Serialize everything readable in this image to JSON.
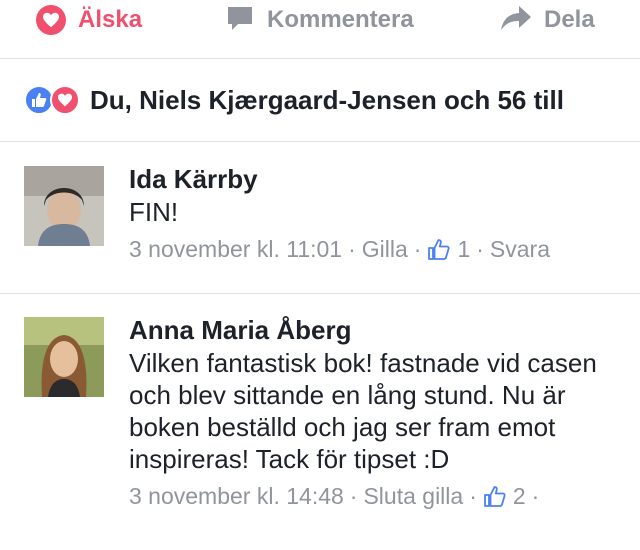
{
  "actions": {
    "love_label": "Älska",
    "comment_label": "Kommentera",
    "share_label": "Dela"
  },
  "reactions": {
    "summary": "Du, Niels Kjærgaard-Jensen och 56 till"
  },
  "comments": [
    {
      "author": "Ida Kärrby",
      "text": "FIN!",
      "timestamp": "3 november kl. 11:01",
      "like_action": "Gilla",
      "like_count": "1",
      "reply_action": "Svara"
    },
    {
      "author": "Anna Maria Åberg",
      "text": "Vilken fantastisk bok! fastnade vid casen och blev sittande en lång stund. Nu är boken beställd och jag ser fram emot inspireras! Tack för tipset :D",
      "timestamp": "3 november kl. 14:48",
      "like_action": "Sluta gilla",
      "like_count": "2"
    }
  ],
  "colors": {
    "love": "#f0506e",
    "like": "#4b80f4",
    "muted": "#90949c",
    "text": "#1d2129",
    "divider": "#dddfe2"
  },
  "icons": [
    "heart-icon",
    "comment-icon",
    "share-icon",
    "like-reaction-icon",
    "love-reaction-icon",
    "thumbs-up-icon"
  ]
}
